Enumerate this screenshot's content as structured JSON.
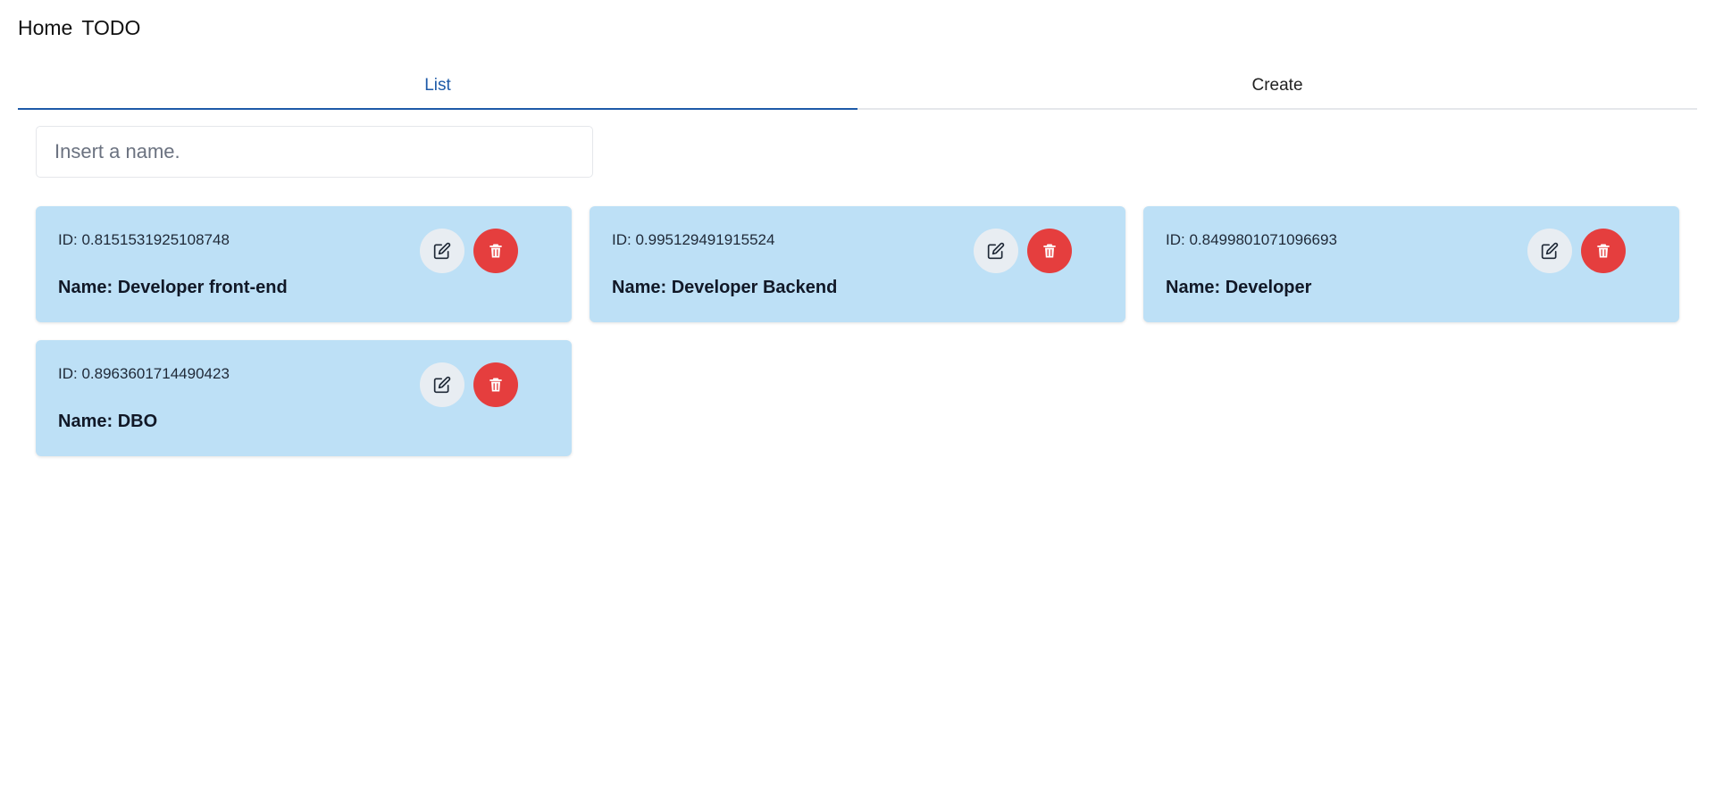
{
  "header": {
    "home_label": "Home",
    "todo_label": "TODO"
  },
  "tabs": [
    {
      "label": "List",
      "active": true
    },
    {
      "label": "Create",
      "active": false
    }
  ],
  "search": {
    "placeholder": "Insert a name.",
    "value": ""
  },
  "cards": [
    {
      "id_text": "ID: 0.8151531925108748",
      "name_prefix": "Name: ",
      "name": "Developer front-end"
    },
    {
      "id_text": "ID: 0.995129491915524",
      "name_prefix": "Name: ",
      "name": "Developer Backend"
    },
    {
      "id_text": "ID: 0.8499801071096693",
      "name_prefix": "Name: ",
      "name": "Developer"
    },
    {
      "id_text": "ID: 0.8963601714490423",
      "name_prefix": "Name: ",
      "name": "DBO"
    }
  ],
  "icons": {
    "edit": "edit-icon",
    "delete": "trash-icon"
  },
  "colors": {
    "accent": "#1e5aa8",
    "card_bg": "#bde0f6",
    "delete_bg": "#e53e3e",
    "edit_bg": "#e8edf2"
  }
}
